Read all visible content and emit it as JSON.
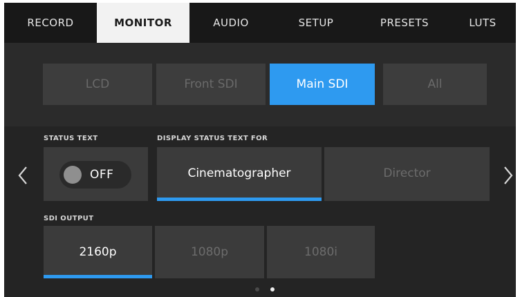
{
  "tabs": [
    {
      "label": "RECORD"
    },
    {
      "label": "MONITOR"
    },
    {
      "label": "AUDIO"
    },
    {
      "label": "SETUP"
    },
    {
      "label": "PRESETS"
    },
    {
      "label": "LUTS"
    }
  ],
  "active_tab": "MONITOR",
  "outputs": [
    {
      "label": "LCD"
    },
    {
      "label": "Front SDI"
    },
    {
      "label": "Main SDI"
    },
    {
      "label": "All"
    }
  ],
  "active_output": "Main SDI",
  "status_text": {
    "label": "STATUS TEXT",
    "toggle_state": "OFF"
  },
  "display_status_text_for": {
    "label": "DISPLAY STATUS TEXT FOR",
    "options": [
      {
        "label": "Cinematographer"
      },
      {
        "label": "Director"
      }
    ],
    "selected": "Cinematographer"
  },
  "sdi_output": {
    "label": "SDI OUTPUT",
    "options": [
      {
        "label": "2160p"
      },
      {
        "label": "1080p"
      },
      {
        "label": "1080i"
      }
    ],
    "selected": "2160p"
  },
  "pagination": {
    "pages": 2,
    "current": 2
  },
  "colors": {
    "accent": "#2e9af0",
    "active_tab_bg": "#f2f2f2",
    "panel_bg": "#2b2b2b",
    "button_bg": "#3b3b3b"
  }
}
